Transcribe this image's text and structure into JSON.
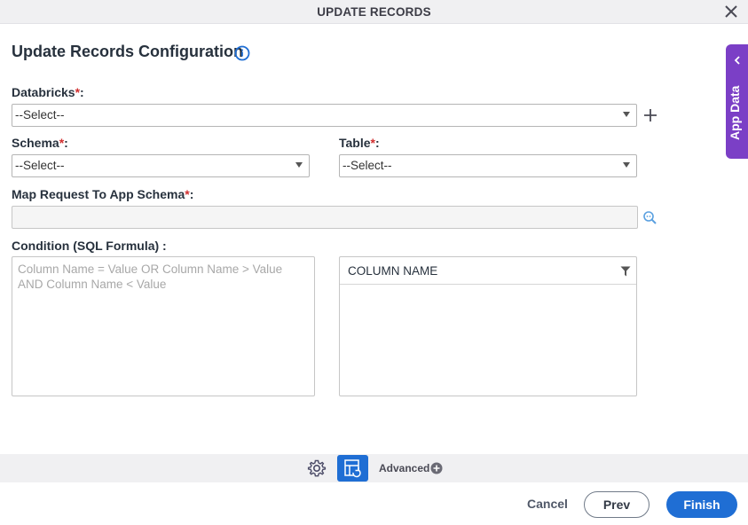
{
  "dialog": {
    "title": "UPDATE RECORDS"
  },
  "heading": "Update Records Configuration",
  "fields": {
    "databricks": {
      "label": "Databricks",
      "required_mark": "*",
      "suffix": ":",
      "value": "--Select--"
    },
    "schema": {
      "label": "Schema",
      "required_mark": "*",
      "suffix": ":",
      "value": "--Select--"
    },
    "table": {
      "label": "Table",
      "required_mark": "*",
      "suffix": ":",
      "value": "--Select--"
    },
    "map_request": {
      "label": "Map Request To App Schema",
      "required_mark": "*",
      "suffix": ":",
      "value": ""
    },
    "condition": {
      "label": "Condition (SQL Formula) :",
      "placeholder": "Column Name = Value OR Column Name > Value AND Column Name < Value"
    }
  },
  "column_panel": {
    "header": "COLUMN NAME"
  },
  "side_tab": {
    "label": "App Data"
  },
  "toolbar": {
    "advanced_label": "Advanced"
  },
  "footer": {
    "cancel": "Cancel",
    "prev": "Prev",
    "finish": "Finish"
  },
  "icons": {
    "close": "close-icon",
    "info": "info-icon",
    "add": "plus-icon",
    "map_search": "search-icon",
    "filter": "filter-icon",
    "collapse": "chevron-left-icon",
    "settings": "gear-icon",
    "flow": "process-flow-icon",
    "advanced_add": "plus-circle-icon"
  },
  "colors": {
    "accent": "#1f6ed4",
    "side_tab": "#7b3fc6",
    "required": "#d12f2f"
  }
}
